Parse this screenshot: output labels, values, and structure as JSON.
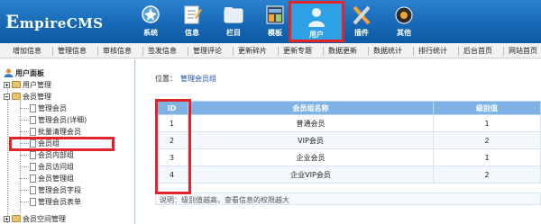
{
  "logo": {
    "text_e": "E",
    "text_rest": "mpireCMS"
  },
  "nav": [
    {
      "label": "系统",
      "icon": "system-icon"
    },
    {
      "label": "信息",
      "icon": "info-icon"
    },
    {
      "label": "栏目",
      "icon": "column-icon"
    },
    {
      "label": "模板",
      "icon": "template-icon"
    },
    {
      "label": "用户",
      "icon": "user-icon",
      "active": true
    },
    {
      "label": "插件",
      "icon": "plugin-icon"
    },
    {
      "label": "其他",
      "icon": "other-icon"
    }
  ],
  "menu": [
    "增加信息",
    "管理信息",
    "审核信息",
    "签发信息",
    "管理评论",
    "更新碎片",
    "更新专题",
    "数据更新",
    "数据统计",
    "排行统计",
    "后台首页",
    "网站首页"
  ],
  "sidebar": {
    "title": "用户面板",
    "items": [
      {
        "label": "用户管理"
      },
      {
        "label": "会员管理"
      },
      {
        "label": "管理会员"
      },
      {
        "label": "管理会员(详细)"
      },
      {
        "label": "批量清理会员"
      },
      {
        "label": "会员组"
      },
      {
        "label": "会员内部组"
      },
      {
        "label": "会员访问组"
      },
      {
        "label": "会员管理组"
      },
      {
        "label": "管理会员字段"
      },
      {
        "label": "管理会员表单"
      },
      {
        "label": "会员空间管理"
      }
    ]
  },
  "main": {
    "position_label": "位置：",
    "position_link": "管理会员组",
    "table": {
      "headers": [
        "ID",
        "会员组名称",
        "级别值"
      ],
      "rows": [
        [
          "1",
          "普通会员",
          "1"
        ],
        [
          "2",
          "VIP会员",
          "2"
        ],
        [
          "3",
          "企业会员",
          "1"
        ],
        [
          "4",
          "企业VIP会员",
          "2"
        ]
      ]
    },
    "note": "说明：级别值越高，查看信息的权限越大"
  },
  "colors": {
    "header": "#1667b3",
    "highlight": "#e0242a",
    "table_header": "#7fb3e6"
  }
}
